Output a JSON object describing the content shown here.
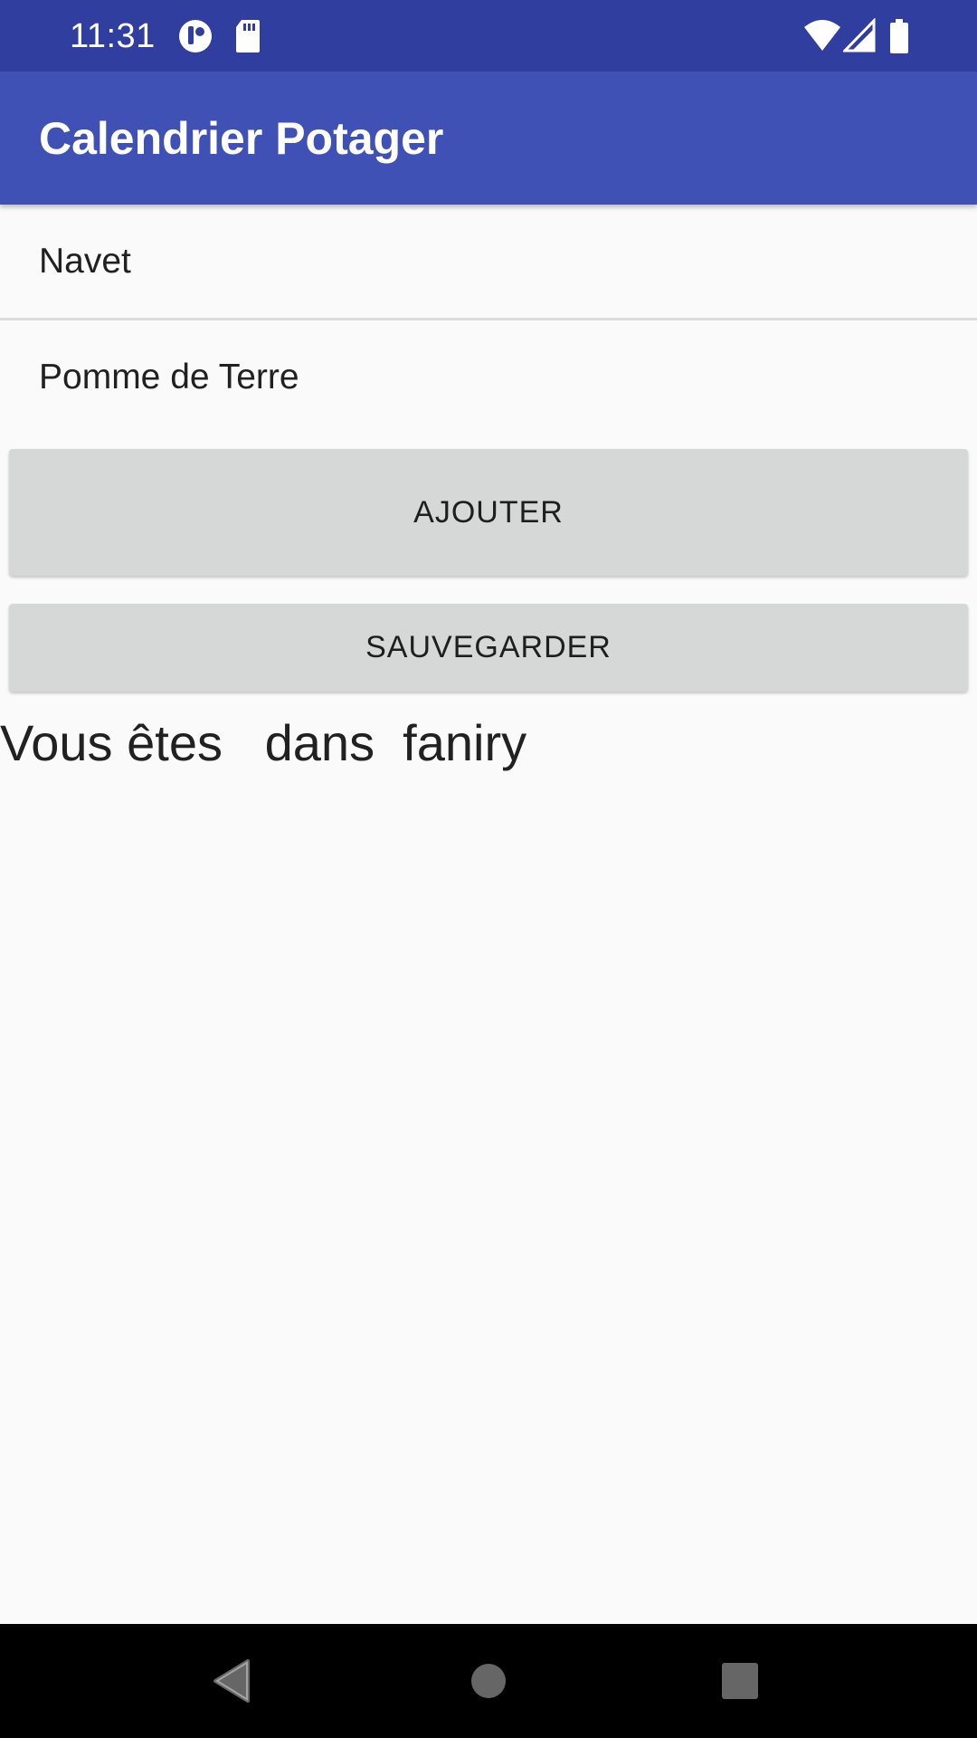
{
  "status_bar": {
    "time": "11:31",
    "icons": [
      "app-notification-icon",
      "sd-card-icon",
      "wifi-icon",
      "cellular-signal-icon",
      "battery-icon"
    ]
  },
  "app_bar": {
    "title": "Calendrier Potager",
    "color": "#3f51b5",
    "status_color": "#303f9f"
  },
  "list": {
    "items": [
      {
        "label": "Navet"
      },
      {
        "label": "Pomme de Terre"
      }
    ]
  },
  "buttons": {
    "add_label": "AJOUTER",
    "save_label": "SAUVEGARDER",
    "background": "#d6d7d7"
  },
  "message": {
    "text": "Vous êtes   dans  faniry"
  },
  "nav_bar": {
    "icons": [
      "back-icon",
      "home-icon",
      "recents-icon"
    ]
  }
}
